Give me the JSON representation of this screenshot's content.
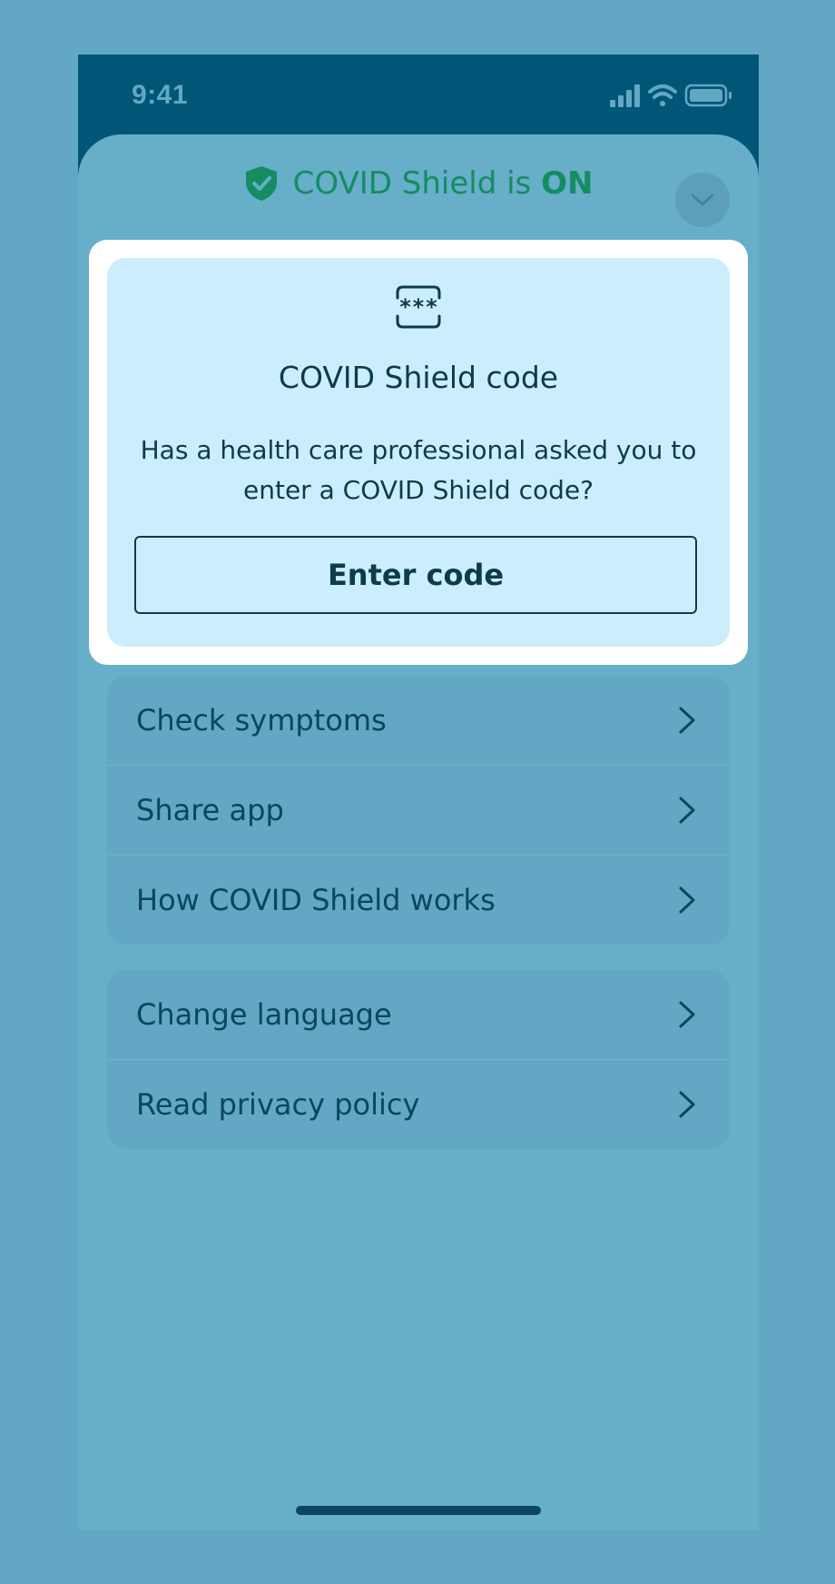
{
  "status_bar": {
    "time": "9:41"
  },
  "header": {
    "shield_prefix": "COVID Shield is ",
    "shield_status": "ON"
  },
  "code_card": {
    "title": "COVID Shield code",
    "body": "Has a health care professional asked you to enter a COVID Shield code?",
    "button_label": "Enter code"
  },
  "menu_group_1": [
    {
      "label": "Check symptoms"
    },
    {
      "label": "Share app"
    },
    {
      "label": "How COVID Shield works"
    }
  ],
  "menu_group_2": [
    {
      "label": "Change language"
    },
    {
      "label": "Read privacy policy"
    }
  ],
  "icons": {
    "shield": "shield-check-icon",
    "code": "code-asterisks-icon",
    "collapse": "chevron-down-icon",
    "menu": "chevron-right-icon"
  },
  "colors": {
    "background": "#62a7c3",
    "status_bar": "#015677",
    "sheet": "#67aec9",
    "shield_green": "#158c62",
    "card": "#cceefc",
    "text_dark": "#0d3b4c"
  }
}
